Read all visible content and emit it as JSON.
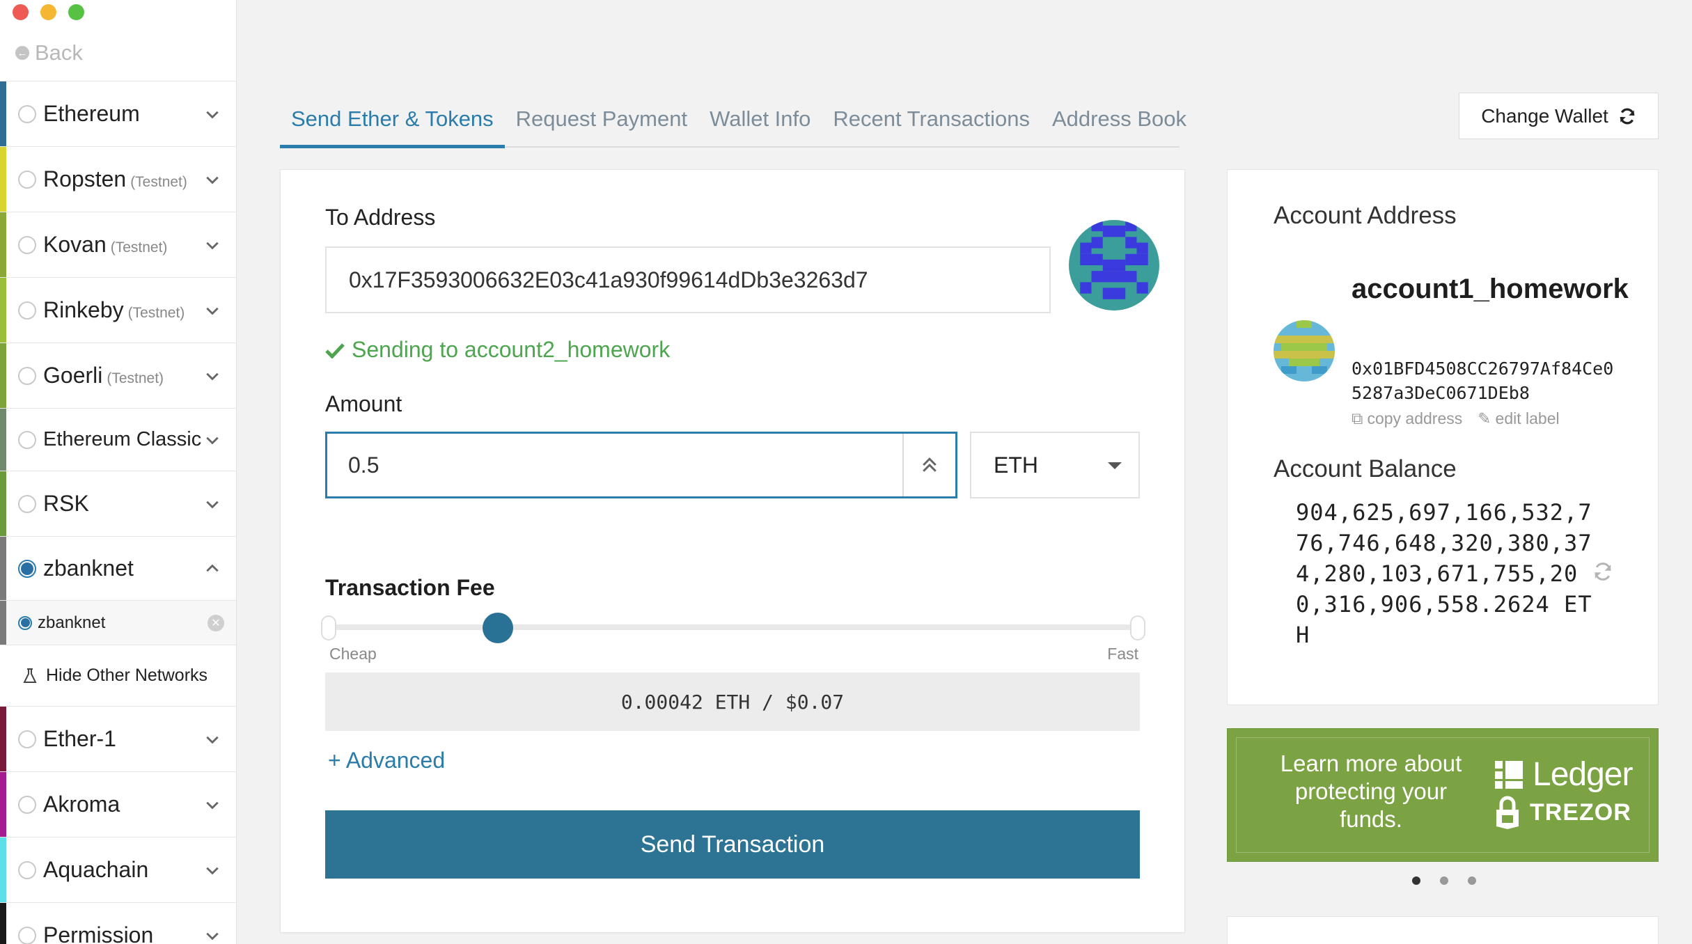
{
  "window": {
    "traffic_colors": [
      "#ee5b55",
      "#f5b731",
      "#57c143"
    ]
  },
  "sidebar": {
    "back_label": "Back",
    "networks": [
      {
        "label": "Ethereum",
        "testnet": "",
        "color": "#2f6d92",
        "selected": false,
        "expanded": false
      },
      {
        "label": "Ropsten",
        "testnet": "(Testnet)",
        "color": "#d8d432",
        "selected": false,
        "expanded": false
      },
      {
        "label": "Kovan",
        "testnet": "(Testnet)",
        "color": "#8aa836",
        "selected": false,
        "expanded": false
      },
      {
        "label": "Rinkeby",
        "testnet": "(Testnet)",
        "color": "#9bbf38",
        "selected": false,
        "expanded": false
      },
      {
        "label": "Goerli",
        "testnet": "(Testnet)",
        "color": "#7ea33a",
        "selected": false,
        "expanded": false
      },
      {
        "label": "Ethereum Classic",
        "testnet": "",
        "color": "#6f8a6c",
        "selected": false,
        "expanded": false
      },
      {
        "label": "RSK",
        "testnet": "",
        "color": "#6b9a3a",
        "selected": false,
        "expanded": false
      },
      {
        "label": "zbanknet",
        "testnet": "",
        "color": "#7a7a7a",
        "selected": true,
        "expanded": true
      }
    ],
    "sub_item": {
      "label": "zbanknet",
      "color": "#7a7a7a"
    },
    "hide_label": "Hide Other Networks",
    "networks_after": [
      {
        "label": "Ether-1",
        "color": "#7a1a3a"
      },
      {
        "label": "Akroma",
        "color": "#a51c8e"
      },
      {
        "label": "Aquachain",
        "color": "#5be0ea"
      },
      {
        "label": "Permission",
        "color": "#1a1a1a"
      }
    ]
  },
  "tabs": [
    {
      "label": "Send Ether & Tokens",
      "active": true
    },
    {
      "label": "Request Payment",
      "active": false
    },
    {
      "label": "Wallet Info",
      "active": false
    },
    {
      "label": "Recent Transactions",
      "active": false
    },
    {
      "label": "Address Book",
      "active": false
    }
  ],
  "change_wallet_label": "Change Wallet",
  "send": {
    "to_address_label": "To Address",
    "to_address_value": "0x17F3593006632E03c41a930f99614dDb3e3263d7",
    "sending_to": "Sending to account2_homework",
    "amount_label": "Amount",
    "amount_value": "0.5",
    "unit": "ETH",
    "fee_label": "Transaction Fee",
    "fee_slider_level": 0.21,
    "cheap_label": "Cheap",
    "fast_label": "Fast",
    "fee_value": "0.00042 ETH / $0.07",
    "advanced_label": "+ Advanced",
    "send_button_label": "Send Transaction",
    "accent": "#2a7cab",
    "success": "#4ea54f"
  },
  "account": {
    "title": "Account Address",
    "name": "account1_homework",
    "address": "0x01BFD4508CC26797Af84Ce05287a3DeC0671DEb8",
    "copy_label": "copy address",
    "edit_label": "edit label",
    "balance_title": "Account Balance",
    "balance_value": "904,625,697,166,532,776,746,648,320,380,374,280,103,671,755,200,316,906,558.2624 ETH"
  },
  "promo": {
    "text": "Learn more about protecting your funds.",
    "ledger": "Ledger",
    "trezor": "TREZOR",
    "background": "#7ba344"
  }
}
